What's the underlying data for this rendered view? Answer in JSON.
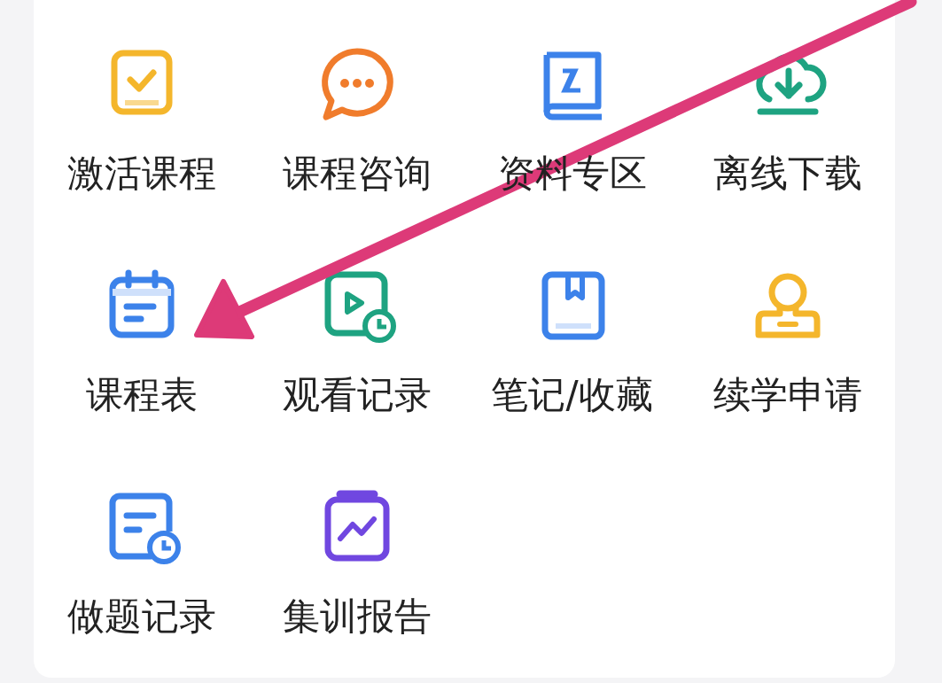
{
  "menu_items": [
    {
      "label": "激活课程"
    },
    {
      "label": "课程咨询"
    },
    {
      "label": "资料专区"
    },
    {
      "label": "离线下载"
    },
    {
      "label": "课程表"
    },
    {
      "label": "观看记录"
    },
    {
      "label": "笔记/收藏"
    },
    {
      "label": "续学申请"
    },
    {
      "label": "做题记录"
    },
    {
      "label": "集训报告"
    }
  ],
  "annotation": {
    "kind": "arrow"
  }
}
